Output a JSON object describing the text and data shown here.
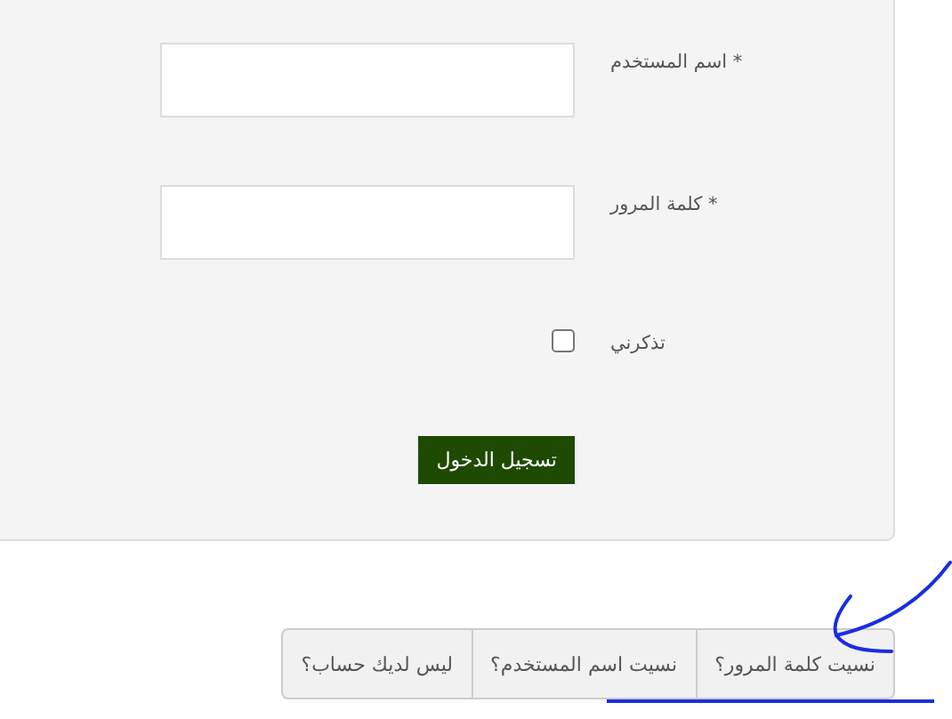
{
  "form": {
    "fields": [
      {
        "label": "* اسم المستخدم"
      },
      {
        "label": "* كلمة المرور"
      }
    ],
    "remember": {
      "label": "تذكرني",
      "checked": false
    },
    "submit": "تسجيل الدخول"
  },
  "links": [
    {
      "label": "نسيت كلمة المرور؟"
    },
    {
      "label": "نسيت اسم المستخدم؟"
    },
    {
      "label": "ليس لديك حساب؟"
    }
  ]
}
